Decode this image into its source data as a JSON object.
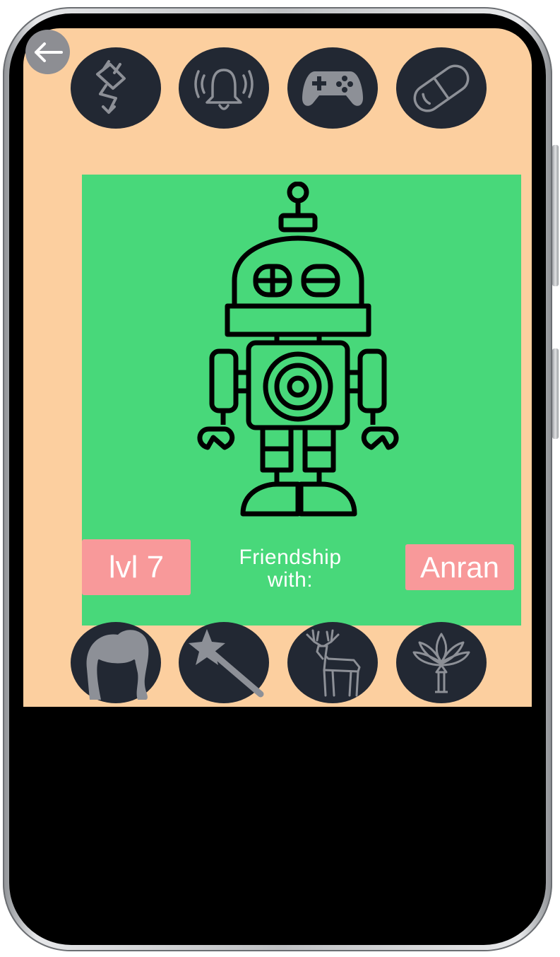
{
  "colors": {
    "screen_background": "#fccf9f",
    "pet_panel": "#48d87a",
    "button_dark": "#222833",
    "icon_gray": "#8d9097",
    "badge_pink": "#f8999a"
  },
  "top_actions": [
    {
      "icon": "plug-charge-icon"
    },
    {
      "icon": "bell-ringing-icon"
    },
    {
      "icon": "gamepad-icon"
    },
    {
      "icon": "pill-icon"
    }
  ],
  "bottom_actions": [
    {
      "icon": "hair-icon"
    },
    {
      "icon": "magic-wand-icon"
    },
    {
      "icon": "deer-icon"
    },
    {
      "icon": "lotus-tree-icon"
    }
  ],
  "pet": {
    "avatar_icon": "robot-icon",
    "level_label": "lvl 7",
    "friendship_line1": "Friendship",
    "friendship_line2": "with:",
    "friend_name": "Anran"
  }
}
